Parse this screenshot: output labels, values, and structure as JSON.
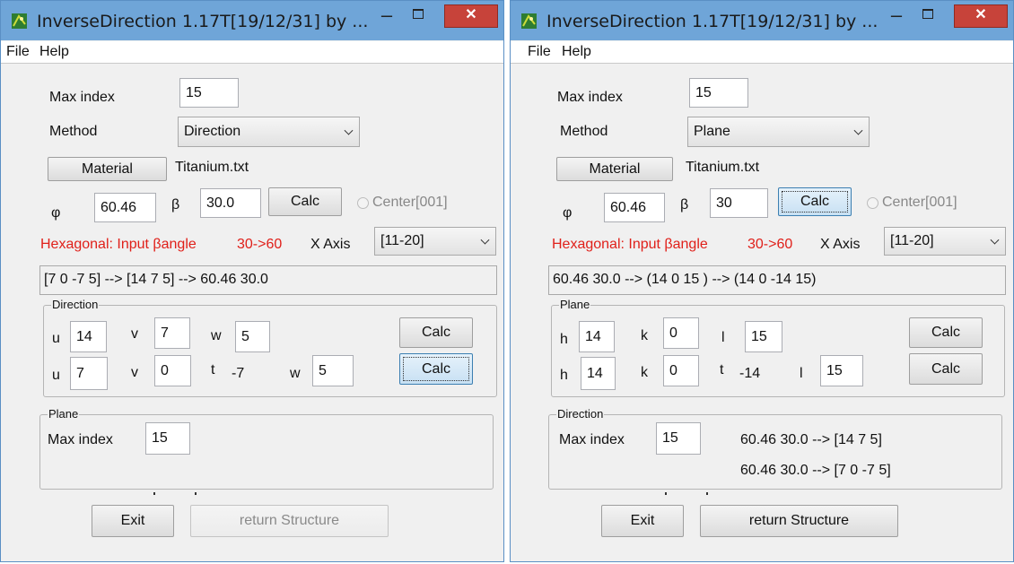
{
  "colors": {
    "title_bar": "#6fa5d8",
    "close_button": "#c7433a",
    "warning_text": "#e0201a",
    "window_bg": "#f0f0f0"
  },
  "windows": [
    {
      "title": "InverseDirection 1.17T[19/12/31] by ...",
      "menu": [
        "File",
        "Help"
      ],
      "max_index_label": "Max index",
      "max_index_value": "15",
      "method_label": "Method",
      "method_value": "Direction",
      "material_button": "Material",
      "material_file": "Titanium.txt",
      "phi_label": "φ",
      "phi_value": "60.46",
      "beta_label": "β",
      "beta_value": "30.0",
      "calc_label": "Calc",
      "center_label": "Center[001]",
      "hex_note": "Hexagonal: Input βangle",
      "range_note": "30->60",
      "xaxis_label": "X Axis",
      "xaxis_value": "[11-20]",
      "result_text": "[7 0 -7 5] --> [14 7 5] --> 60.46 30.0",
      "group1": {
        "title": "Direction",
        "row1": {
          "l1": "u",
          "v1": "14",
          "l2": "v",
          "v2": "7",
          "l3": "w",
          "v3": "5",
          "calc": "Calc"
        },
        "row2": {
          "l1": "u",
          "v1": "7",
          "l2": "v",
          "v2": "0",
          "l3": "t",
          "v3": "-7",
          "l4": "w",
          "v4": "5",
          "calc": "Calc"
        }
      },
      "group2": {
        "title": "Plane",
        "max_index_label": "Max index",
        "max_index_value": "15"
      },
      "exit_button": "Exit",
      "return_button": "return Structure"
    },
    {
      "title": "InverseDirection 1.17T[19/12/31] by ...",
      "menu": [
        "File",
        "Help"
      ],
      "max_index_label": "Max index",
      "max_index_value": "15",
      "method_label": "Method",
      "method_value": "Plane",
      "material_button": "Material",
      "material_file": "Titanium.txt",
      "phi_label": "φ",
      "phi_value": "60.46",
      "beta_label": "β",
      "beta_value": "30",
      "calc_label": "Calc",
      "center_label": "Center[001]",
      "hex_note": "Hexagonal: Input βangle",
      "range_note": "30->60",
      "xaxis_label": "X Axis",
      "xaxis_value": "[11-20]",
      "result_text": "60.46 30.0 --> (14 0 15 ) --> (14 0 -14 15)",
      "group1": {
        "title": "Plane",
        "row1": {
          "l1": "h",
          "v1": "14",
          "l2": "k",
          "v2": "0",
          "l3": "l",
          "v3": "15",
          "calc": "Calc"
        },
        "row2": {
          "l1": "h",
          "v1": "14",
          "l2": "k",
          "v2": "0",
          "l3": "t",
          "v3": "-14",
          "l4": "l",
          "v4": "15",
          "calc": "Calc"
        }
      },
      "group2": {
        "title": "Direction",
        "max_index_label": "Max index",
        "max_index_value": "15",
        "result_line1": "60.46 30.0 --> [14 7 5]",
        "result_line2": "60.46 30.0 --> [7 0 -7 5]"
      },
      "exit_button": "Exit",
      "return_button": "return Structure"
    }
  ]
}
